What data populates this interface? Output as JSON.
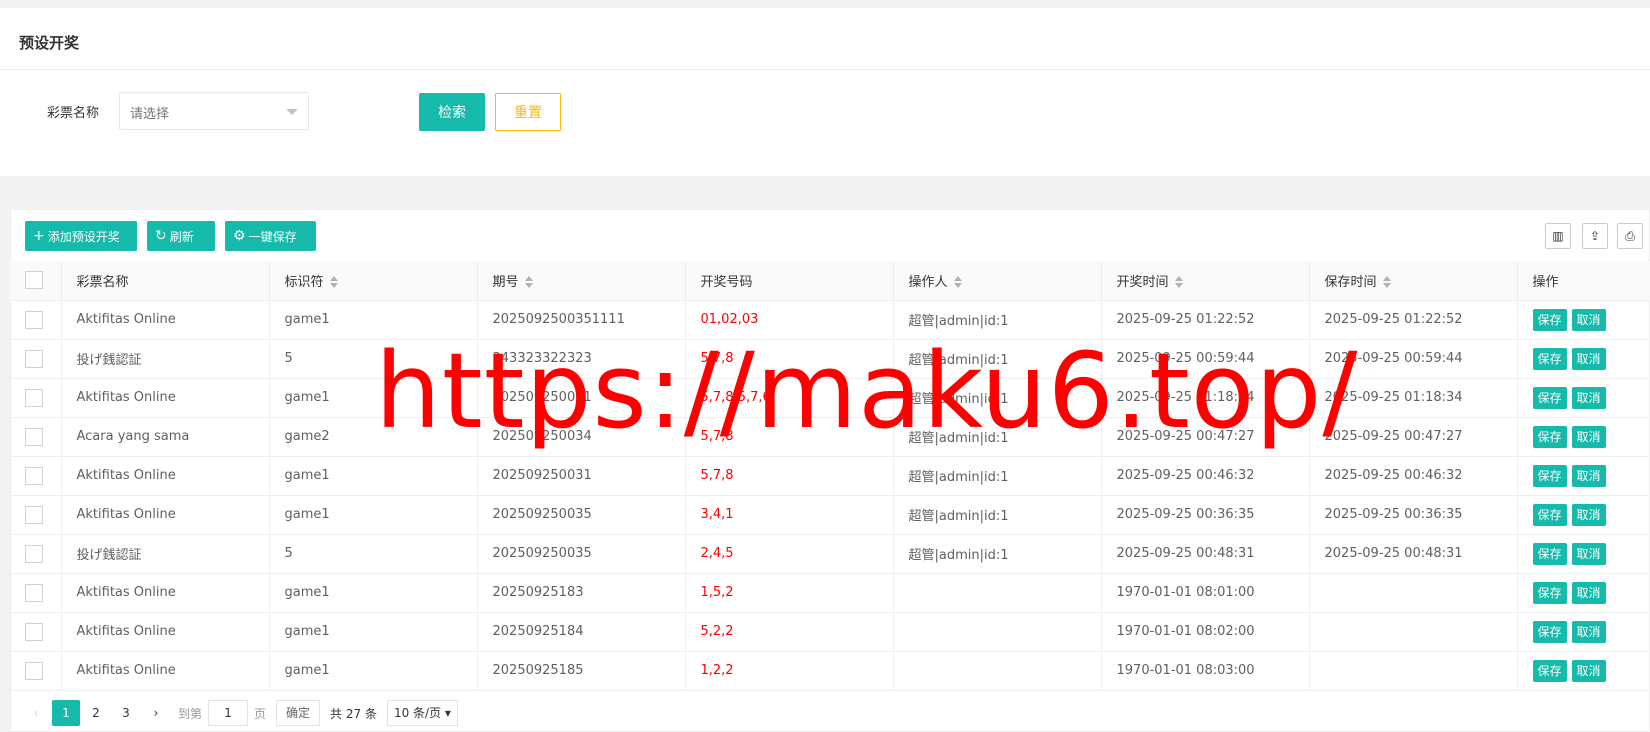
{
  "page_title": "预设开奖",
  "filter": {
    "label": "彩票名称",
    "placeholder": "请选择",
    "search_label": "检索",
    "reset_label": "重置"
  },
  "toolbar": {
    "add_label": "添加预设开奖",
    "refresh_label": "刷新",
    "save_all_label": "一键保存"
  },
  "table": {
    "headers": [
      "彩票名称",
      "标识符",
      "期号",
      "开奖号码",
      "操作人",
      "开奖时间",
      "保存时间",
      "操作"
    ],
    "rows": [
      {
        "name": "Aktifitas Online",
        "code": "game1",
        "issue": "2025092500351111",
        "numbers": "01,02,03",
        "operator": "超管|admin|id:1",
        "draw_time": "2025-09-25 01:22:52",
        "save_time": "2025-09-25 01:22:52"
      },
      {
        "name": "投げ銭認証",
        "code": "5",
        "issue": "343323322323",
        "numbers": "5,7,8",
        "operator": "超管|admin|id:1",
        "draw_time": "2025-09-25 00:59:44",
        "save_time": "2025-09-25 00:59:44"
      },
      {
        "name": "Aktifitas Online",
        "code": "game1",
        "issue": "202509250031",
        "numbers": "5,7,8,5,7,6",
        "operator": "超管|admin|id:1",
        "draw_time": "2025-09-25 01:18:34",
        "save_time": "2025-09-25 01:18:34"
      },
      {
        "name": "Acara yang sama",
        "code": "game2",
        "issue": "202509250034",
        "numbers": "5,7,8",
        "operator": "超管|admin|id:1",
        "draw_time": "2025-09-25 00:47:27",
        "save_time": "2025-09-25 00:47:27"
      },
      {
        "name": "Aktifitas Online",
        "code": "game1",
        "issue": "202509250031",
        "numbers": "5,7,8",
        "operator": "超管|admin|id:1",
        "draw_time": "2025-09-25 00:46:32",
        "save_time": "2025-09-25 00:46:32"
      },
      {
        "name": "Aktifitas Online",
        "code": "game1",
        "issue": "202509250035",
        "numbers": "3,4,1",
        "operator": "超管|admin|id:1",
        "draw_time": "2025-09-25 00:36:35",
        "save_time": "2025-09-25 00:36:35"
      },
      {
        "name": "投げ銭認証",
        "code": "5",
        "issue": "202509250035",
        "numbers": "2,4,5",
        "operator": "超管|admin|id:1",
        "draw_time": "2025-09-25 00:48:31",
        "save_time": "2025-09-25 00:48:31"
      },
      {
        "name": "Aktifitas Online",
        "code": "game1",
        "issue": "20250925183",
        "numbers": "1,5,2",
        "operator": "",
        "draw_time": "1970-01-01 08:01:00",
        "save_time": ""
      },
      {
        "name": "Aktifitas Online",
        "code": "game1",
        "issue": "20250925184",
        "numbers": "5,2,2",
        "operator": "",
        "draw_time": "1970-01-01 08:02:00",
        "save_time": ""
      },
      {
        "name": "Aktifitas Online",
        "code": "game1",
        "issue": "20250925185",
        "numbers": "1,2,2",
        "operator": "",
        "draw_time": "1970-01-01 08:03:00",
        "save_time": ""
      }
    ],
    "save_label": "保存",
    "cancel_label": "取消"
  },
  "pager": {
    "pages": [
      "1",
      "2",
      "3"
    ],
    "current": "1",
    "goto_label": "到第",
    "goto_value": "1",
    "page_unit": "页",
    "confirm_label": "确定",
    "total_label": "共 27 条",
    "page_size": "10 条/页"
  },
  "watermark": "https://maku6.top/",
  "colors": {
    "accent": "#16baaa",
    "reset": "#ffb800",
    "highlight": "#ff0000"
  }
}
